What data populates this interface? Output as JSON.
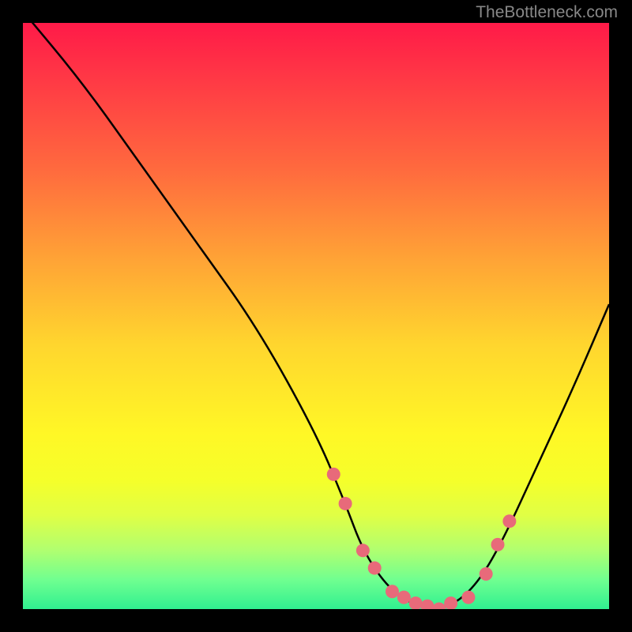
{
  "watermark": "TheBottleneck.com",
  "chart_data": {
    "type": "line",
    "title": "",
    "xlabel": "",
    "ylabel": "",
    "xlim": [
      0,
      100
    ],
    "ylim": [
      0,
      100
    ],
    "series": [
      {
        "name": "bottleneck-curve",
        "x": [
          0,
          10,
          20,
          30,
          40,
          50,
          55,
          58,
          62,
          66,
          70,
          74,
          78,
          82,
          88,
          94,
          100
        ],
        "values": [
          102,
          90,
          76,
          62,
          48,
          30,
          18,
          10,
          4,
          1,
          0,
          1,
          5,
          12,
          25,
          38,
          52
        ]
      }
    ],
    "markers": {
      "name": "highlight-points",
      "color": "#e86a7a",
      "x": [
        53,
        55,
        58,
        60,
        63,
        65,
        67,
        69,
        71,
        73,
        76,
        79,
        81,
        83
      ],
      "values": [
        23,
        18,
        10,
        7,
        3,
        2,
        1,
        0.5,
        0,
        1,
        2,
        6,
        11,
        15
      ]
    }
  }
}
